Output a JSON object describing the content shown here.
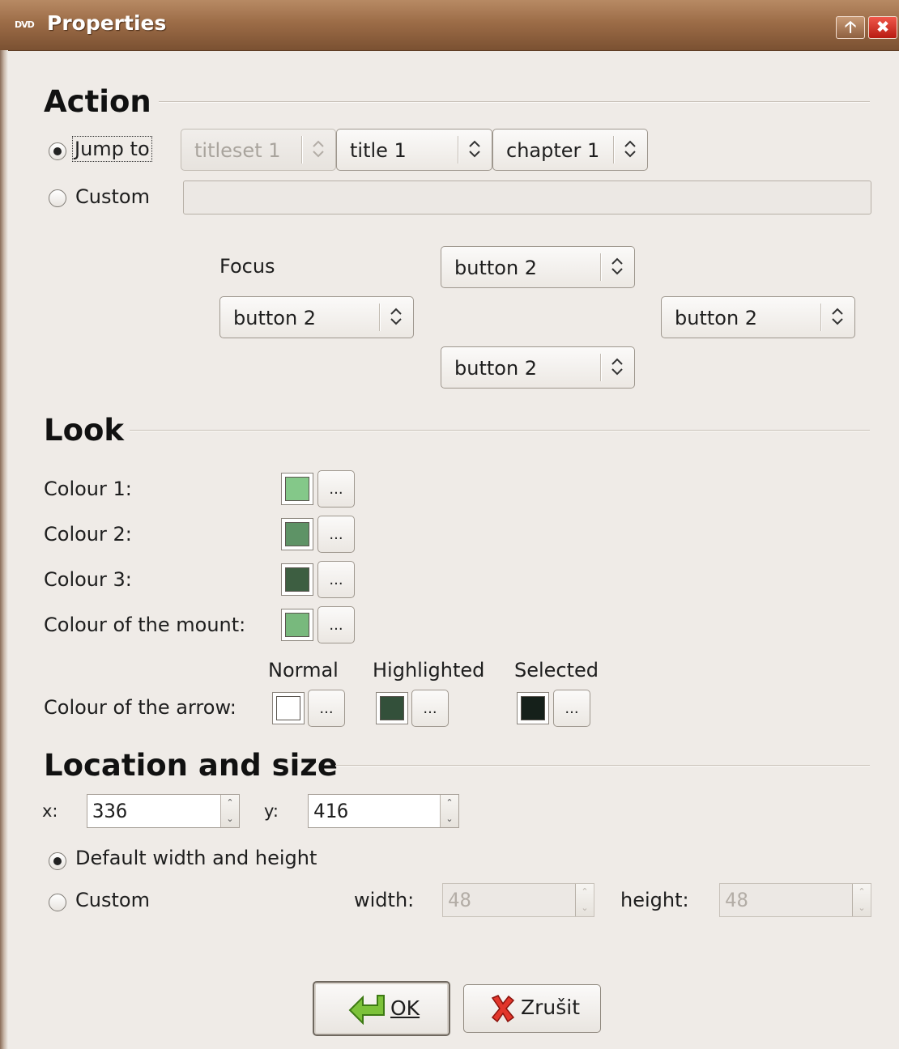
{
  "window": {
    "title": "Properties",
    "app_icon_text": "DVD",
    "controls": [
      "maximize-icon",
      "close-icon"
    ]
  },
  "action": {
    "section_title": "Action",
    "jump_to_label": "Jump to",
    "jump_to_selected": true,
    "titleset_value": "titleset 1",
    "title_value": "title 1",
    "chapter_value": "chapter 1",
    "custom_label": "Custom",
    "custom_value": "",
    "focus_label": "Focus",
    "focus_up": "button 2",
    "focus_left": "button 2",
    "focus_right": "button 2",
    "focus_down": "button 2"
  },
  "look": {
    "section_title": "Look",
    "colour1_label": "Colour 1:",
    "colour2_label": "Colour 2:",
    "colour3_label": "Colour 3:",
    "mount_label": "Colour of the mount:",
    "arrow_label": "Colour of the arrow:",
    "col_normal": "Normal",
    "col_highlighted": "Highlighted",
    "col_selected": "Selected",
    "dots_label": "...",
    "colors": {
      "colour1": "#84c889",
      "colour2": "#5e9366",
      "colour3": "#3d5e41",
      "mount": "#78b97d",
      "arrow_normal": "#ffffff",
      "arrow_highlighted": "#33503a",
      "arrow_selected": "#15201a"
    }
  },
  "location": {
    "section_title": "Location and size",
    "x_label": "x:",
    "x_value": "336",
    "y_label": "y:",
    "y_value": "416",
    "default_label": "Default width and height",
    "default_selected": true,
    "custom_label": "Custom",
    "width_label": "width:",
    "width_value": "48",
    "height_label": "height:",
    "height_value": "48"
  },
  "buttons": {
    "ok_label": "OK",
    "cancel_label": "Zrušit"
  }
}
